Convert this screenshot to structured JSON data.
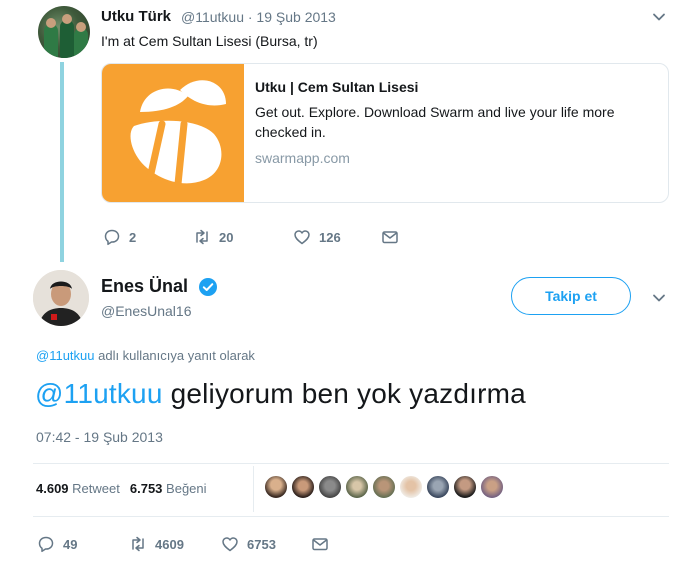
{
  "parent_tweet": {
    "author_name": "Utku Türk",
    "handle_and_date": "@11utkuu · 19 Şub 2013",
    "text": "I'm at Cem Sultan Lisesi (Bursa, tr)",
    "card": {
      "title": "Utku | Cem Sultan Lisesi",
      "description": "Get out. Explore. Download Swarm and live your life more checked in.",
      "url": "swarmapp.com",
      "image_color": "#f7a131"
    },
    "actions": {
      "replies": "2",
      "retweets": "20",
      "likes": "126"
    }
  },
  "main_tweet": {
    "author_name": "Enes Ünal",
    "handle": "@EnesUnal16",
    "verified": true,
    "follow_label": "Takip et",
    "reply_to": {
      "mention": "@11utkuu",
      "suffix": " adlı kullanıcıya yanıt olarak"
    },
    "text": {
      "mention": "@11utkuu",
      "body": " geliyorum ben yok yazdırma"
    },
    "timestamp": "07:42 - 19 Şub 2013",
    "stats": {
      "retweets_count": "4.609",
      "retweets_label": "Retweet",
      "likes_count": "6.753",
      "likes_label": "Beğeni"
    },
    "actions": {
      "replies": "49",
      "retweets": "4609",
      "likes": "6753"
    }
  },
  "colors": {
    "accent": "#1da1f2",
    "thread_line": "#8fd3e0",
    "muted_text": "#657786"
  },
  "icons": [
    "chevron-down-icon",
    "reply-icon",
    "retweet-icon",
    "like-icon",
    "message-icon",
    "verified-badge-icon",
    "swarm-bee-icon"
  ]
}
